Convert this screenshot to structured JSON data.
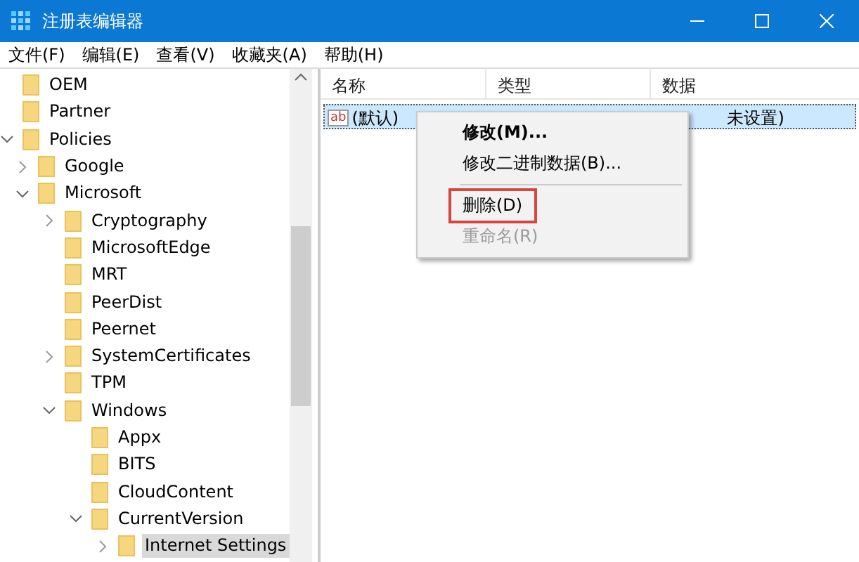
{
  "window": {
    "title": "注册表编辑器"
  },
  "menu": [
    "文件(F)",
    "编辑(E)",
    "查看(V)",
    "收藏夹(A)",
    "帮助(H)"
  ],
  "tree": [
    {
      "label": "OEM",
      "selected": false
    },
    {
      "label": "Partner",
      "selected": false
    },
    {
      "label": "Policies",
      "selected": false,
      "expanded": true,
      "children": [
        {
          "label": "Google",
          "selected": false,
          "expanded": false
        },
        {
          "label": "Microsoft",
          "selected": false,
          "expanded": true,
          "children": [
            {
              "label": "Cryptography",
              "selected": false,
              "expanded": false
            },
            {
              "label": "MicrosoftEdge",
              "selected": false
            },
            {
              "label": "MRT",
              "selected": false
            },
            {
              "label": "PeerDist",
              "selected": false
            },
            {
              "label": "Peernet",
              "selected": false
            },
            {
              "label": "SystemCertificates",
              "selected": false,
              "expanded": false
            },
            {
              "label": "TPM",
              "selected": false
            },
            {
              "label": "Windows",
              "selected": false,
              "expanded": true,
              "children": [
                {
                  "label": "Appx",
                  "selected": false
                },
                {
                  "label": "BITS",
                  "selected": false
                },
                {
                  "label": "CloudContent",
                  "selected": false
                },
                {
                  "label": "CurrentVersion",
                  "selected": false,
                  "expanded": true,
                  "children": [
                    {
                      "label": "Internet Settings",
                      "selected": true,
                      "expanded": false
                    }
                  ]
                }
              ]
            }
          ]
        }
      ]
    }
  ],
  "table": {
    "columns": [
      "名称",
      "类型",
      "数据"
    ],
    "rows": [
      {
        "icon_label": "ab",
        "name": "(默认)",
        "data": "未设置)",
        "selected": true
      }
    ]
  },
  "context_menu": [
    {
      "kind": "item",
      "label": "修改(M)...",
      "bold": true,
      "disabled": false,
      "outlined": false
    },
    {
      "kind": "item",
      "label": "修改二进制数据(B)...",
      "bold": false,
      "disabled": false,
      "outlined": false
    },
    {
      "kind": "separator"
    },
    {
      "kind": "item",
      "label": "删除(D)",
      "bold": false,
      "disabled": false,
      "outlined": true
    },
    {
      "kind": "item",
      "label": "重命名(R)",
      "bold": false,
      "disabled": true,
      "outlined": false
    }
  ]
}
